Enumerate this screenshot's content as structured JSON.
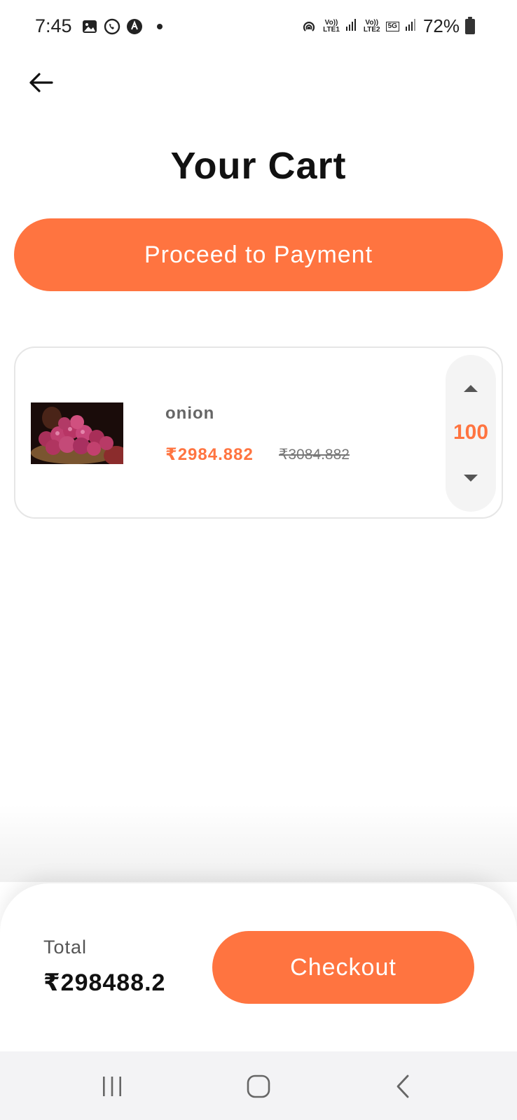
{
  "status_bar": {
    "time": "7:45",
    "sim1": "LTE1",
    "sim2": "LTE2",
    "volte": "Vo))",
    "network": "5G",
    "battery": "72%"
  },
  "header": {
    "title": "Your Cart"
  },
  "actions": {
    "proceed_label": "Proceed to Payment",
    "checkout_label": "Checkout"
  },
  "cart": {
    "items": [
      {
        "name": "onion",
        "price": "₹2984.882",
        "original_price": "₹3084.882",
        "quantity": "100"
      }
    ]
  },
  "summary": {
    "total_label": "Total",
    "total_value": "₹298488.2"
  },
  "colors": {
    "accent": "#ff7440",
    "background": "#ffffff"
  },
  "icons": {
    "back": "arrow-left-icon",
    "qty_up": "triangle-up-icon",
    "qty_down": "triangle-down-icon"
  }
}
